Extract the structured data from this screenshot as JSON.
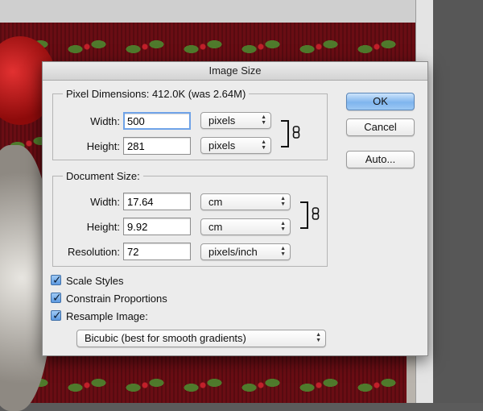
{
  "dialog": {
    "title": "Image Size",
    "pixel_dimensions": {
      "legend": "Pixel Dimensions:",
      "size_info": "412.0K (was 2.64M)",
      "width_label": "Width:",
      "width_value": "500",
      "width_unit": "pixels",
      "height_label": "Height:",
      "height_value": "281",
      "height_unit": "pixels"
    },
    "document_size": {
      "legend": "Document Size:",
      "width_label": "Width:",
      "width_value": "17.64",
      "width_unit": "cm",
      "height_label": "Height:",
      "height_value": "9.92",
      "height_unit": "cm",
      "resolution_label": "Resolution:",
      "resolution_value": "72",
      "resolution_unit": "pixels/inch"
    },
    "options": {
      "scale_styles": {
        "label": "Scale Styles",
        "checked": true
      },
      "constrain_proportions": {
        "label": "Constrain Proportions",
        "checked": true
      },
      "resample_image": {
        "label": "Resample Image:",
        "checked": true
      },
      "resample_method": "Bicubic (best for smooth gradients)"
    },
    "buttons": {
      "ok": "OK",
      "cancel": "Cancel",
      "auto": "Auto..."
    },
    "colors": {
      "default_button": "#7fb5ee",
      "focus_ring": "#6fa3e8",
      "canvas_background": "#6a0d14"
    }
  }
}
